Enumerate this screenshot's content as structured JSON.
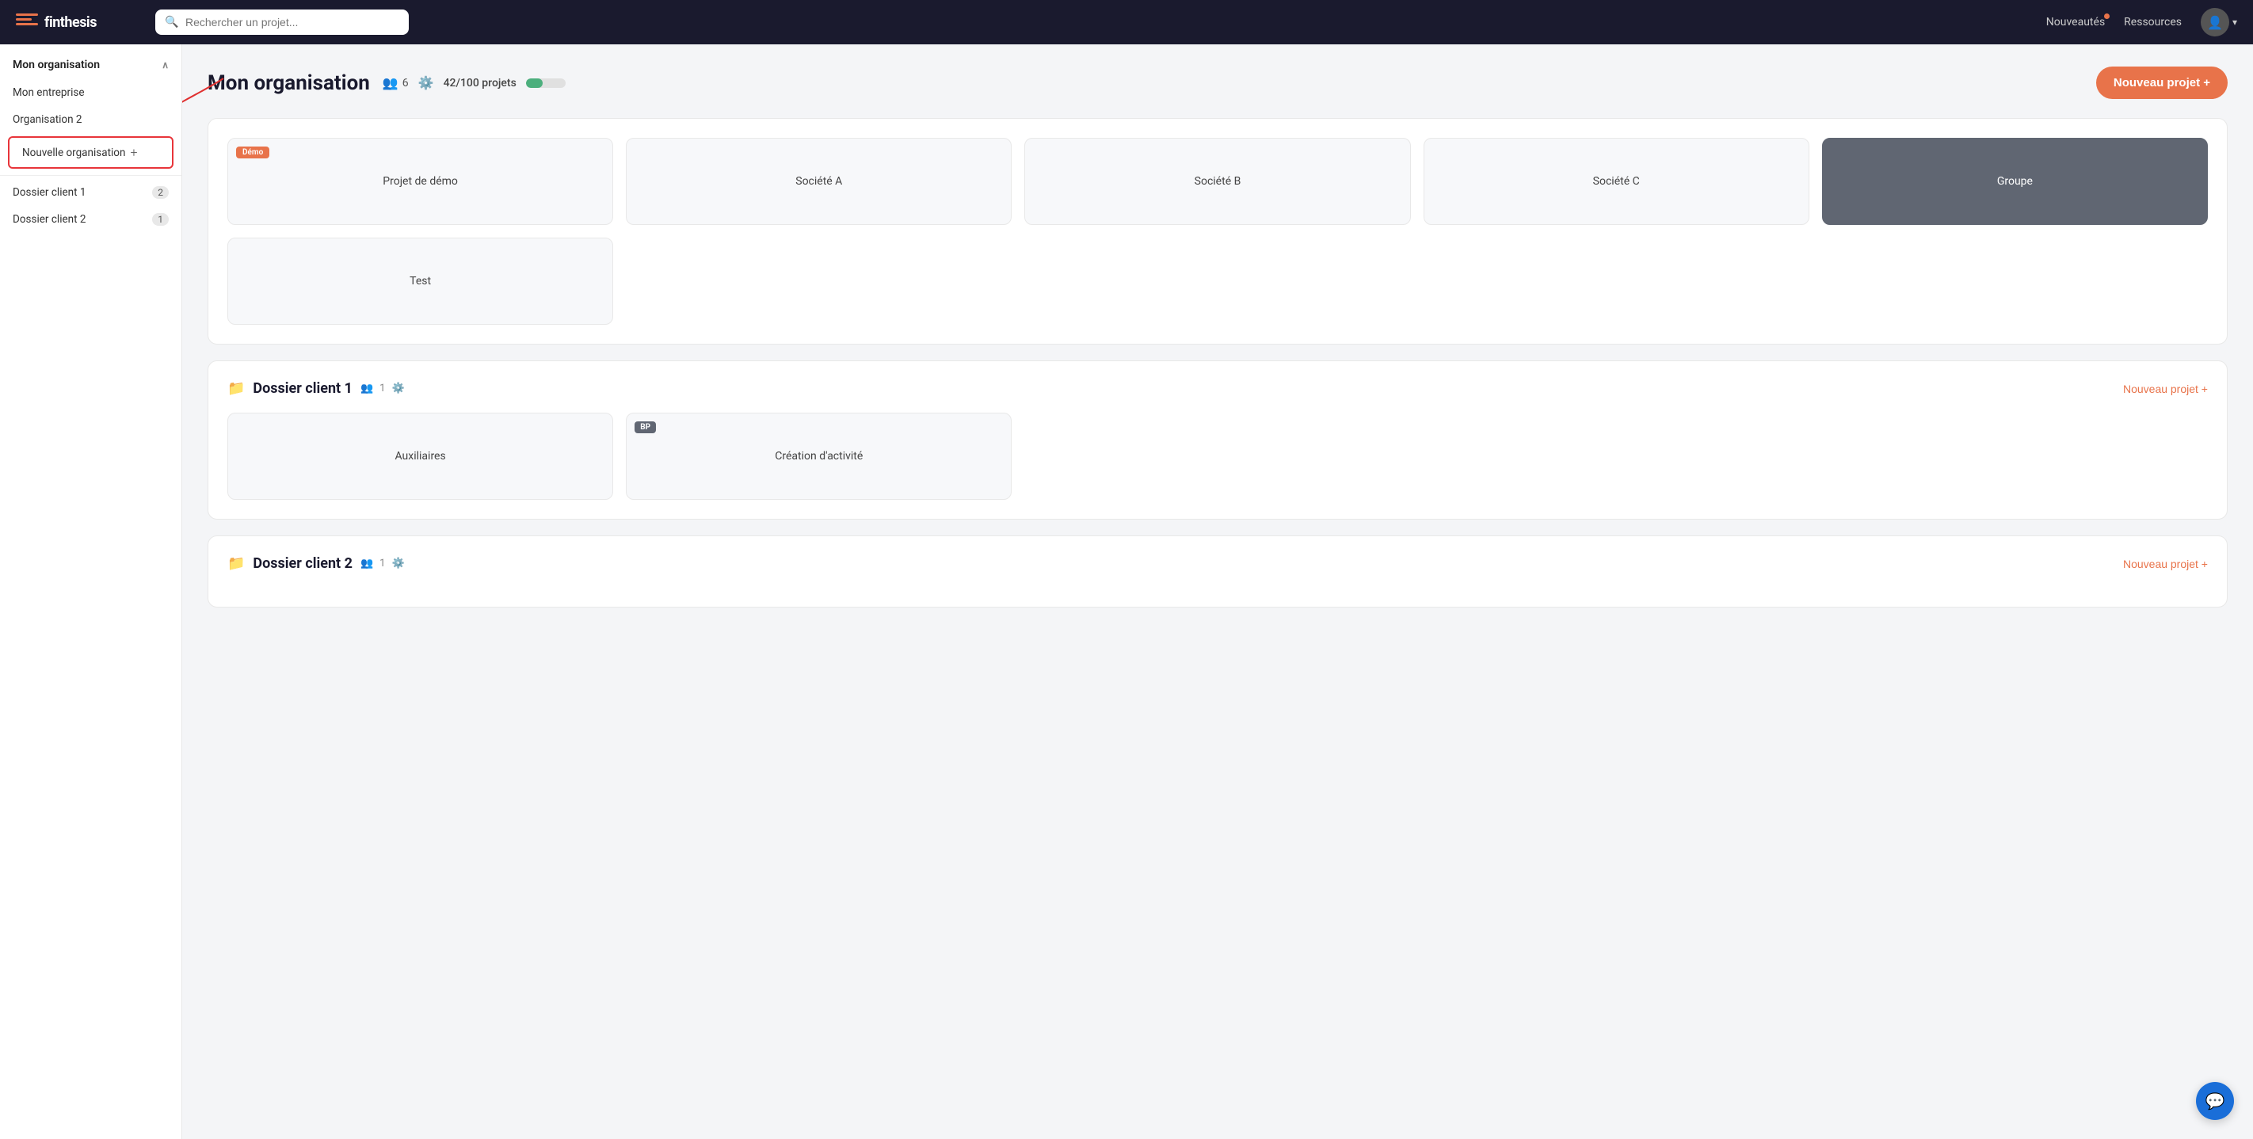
{
  "topnav": {
    "logo_text": "finthesis",
    "search_placeholder": "Rechercher un projet...",
    "link_nouveautes": "Nouveautés",
    "link_ressources": "Ressources"
  },
  "sidebar": {
    "section_label": "Mon organisation",
    "items": [
      {
        "id": "mon-entreprise",
        "label": "Mon entreprise",
        "count": null
      },
      {
        "id": "organisation-2",
        "label": "Organisation 2",
        "count": null
      },
      {
        "id": "nouvelle-organisation",
        "label": "Nouvelle organisation",
        "count": null,
        "is_new": true
      },
      {
        "id": "dossier-client-1",
        "label": "Dossier client 1",
        "count": "2"
      },
      {
        "id": "dossier-client-2",
        "label": "Dossier client 2",
        "count": "1"
      }
    ]
  },
  "page": {
    "title": "Mon organisation",
    "members_count": "6",
    "projects_used": "42",
    "projects_total": "100",
    "projects_label": "42/100 projets",
    "projects_fill_pct": 42,
    "new_project_btn": "Nouveau projet  +"
  },
  "sections": [
    {
      "id": "main-org",
      "title": null,
      "is_main": true,
      "projects": [
        {
          "id": "projet-demo",
          "label": "Projet de démo",
          "tag": "Démo",
          "tag_type": "demo",
          "dark": false
        },
        {
          "id": "societe-a",
          "label": "Société A",
          "tag": null,
          "dark": false
        },
        {
          "id": "societe-b",
          "label": "Société B",
          "tag": null,
          "dark": false
        },
        {
          "id": "societe-c",
          "label": "Société C",
          "tag": null,
          "dark": false
        },
        {
          "id": "groupe",
          "label": "Groupe",
          "tag": null,
          "dark": true
        },
        {
          "id": "test",
          "label": "Test",
          "tag": null,
          "dark": false
        }
      ]
    },
    {
      "id": "dossier-client-1",
      "title": "Dossier client 1",
      "members_count": "1",
      "is_main": false,
      "new_project_label": "Nouveau projet  +",
      "projects": [
        {
          "id": "auxiliaires",
          "label": "Auxiliaires",
          "tag": null,
          "dark": false
        },
        {
          "id": "creation-activite",
          "label": "Création d'activité",
          "tag": "BP",
          "tag_type": "bp",
          "dark": false
        }
      ]
    },
    {
      "id": "dossier-client-2",
      "title": "Dossier client 2",
      "members_count": "1",
      "is_main": false,
      "new_project_label": "Nouveau projet  +"
    }
  ],
  "chat": {
    "icon": "💬"
  }
}
